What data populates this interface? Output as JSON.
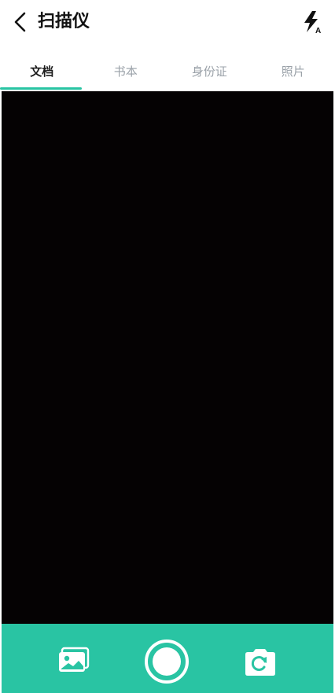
{
  "header": {
    "title": "扫描仪",
    "flash_label": "A"
  },
  "tabs": [
    {
      "label": "文档",
      "active": true
    },
    {
      "label": "书本",
      "active": false
    },
    {
      "label": "身份证",
      "active": false
    },
    {
      "label": "照片",
      "active": false
    }
  ],
  "colors": {
    "accent": "#29c4a3",
    "viewfinder": "#050203",
    "inactive_tab": "#9aa1a8"
  },
  "icons": {
    "back": "chevron-left-icon",
    "flash": "flash-auto-icon",
    "gallery": "gallery-icon",
    "shutter": "shutter-icon",
    "switch_camera": "switch-camera-icon"
  }
}
